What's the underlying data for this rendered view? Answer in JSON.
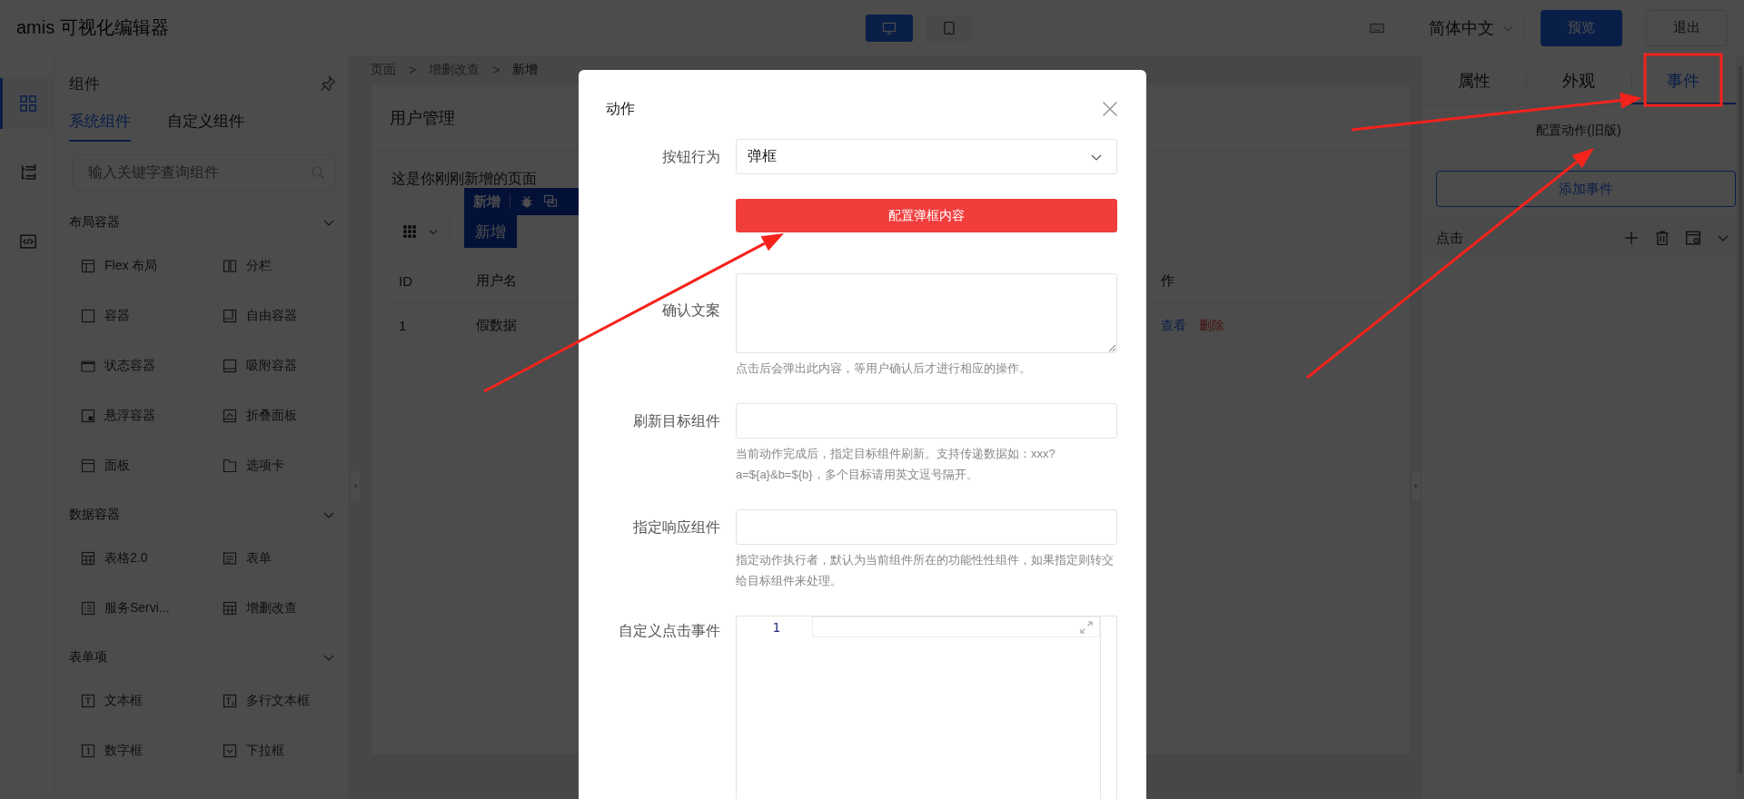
{
  "app": {
    "title": "amis 可视化编辑器"
  },
  "device_toggle": [
    {
      "kind": "desktop",
      "selected": true
    },
    {
      "kind": "tablet",
      "selected": false
    }
  ],
  "header": {
    "language": "简体中文",
    "preview_button": "预览",
    "exit_button": "退出"
  },
  "icon_rail": [
    {
      "kind": "components",
      "selected": true
    },
    {
      "kind": "outline",
      "selected": false
    },
    {
      "kind": "code",
      "selected": false
    }
  ],
  "component_panel": {
    "title": "组件",
    "tabs": [
      {
        "label": "系统组件",
        "selected": true
      },
      {
        "label": "自定义组件",
        "selected": false
      }
    ],
    "search": {
      "placeholder": "输入关键字查询组件"
    },
    "groups": [
      {
        "title": "布局容器",
        "expanded": true,
        "items": [
          {
            "label": "Flex 布局",
            "kind": "flex"
          },
          {
            "label": "分栏",
            "kind": "columns"
          },
          {
            "label": "容器",
            "kind": "container"
          },
          {
            "label": "自由容器",
            "kind": "free"
          },
          {
            "label": "状态容器",
            "kind": "state"
          },
          {
            "label": "吸附容器",
            "kind": "sticky"
          },
          {
            "label": "悬浮容器",
            "kind": "float"
          },
          {
            "label": "折叠面板",
            "kind": "collapse"
          },
          {
            "label": "面板",
            "kind": "panel"
          },
          {
            "label": "选项卡",
            "kind": "tabs"
          }
        ]
      },
      {
        "title": "数据容器",
        "expanded": true,
        "items": [
          {
            "label": "表格2.0",
            "kind": "table"
          },
          {
            "label": "表单",
            "kind": "form"
          },
          {
            "label": "服务Servi...",
            "kind": "service"
          },
          {
            "label": "增删改查",
            "kind": "table"
          }
        ]
      },
      {
        "title": "表单项",
        "expanded": true,
        "items": [
          {
            "label": "文本框",
            "kind": "text"
          },
          {
            "label": "多行文本框",
            "kind": "textarea"
          },
          {
            "label": "数字框",
            "kind": "number"
          },
          {
            "label": "下拉框",
            "kind": "select"
          }
        ]
      }
    ]
  },
  "canvas": {
    "breadcrumb": [
      {
        "label": "页面",
        "kind": "crumb"
      },
      {
        "label": ">",
        "kind": "separator"
      },
      {
        "label": "增删改查",
        "kind": "crumb"
      },
      {
        "label": ">",
        "kind": "separator"
      },
      {
        "label": "新增",
        "kind": "current"
      }
    ],
    "card": {
      "title": "用户管理",
      "description": "这是你刚刚新增的页面",
      "selection_toolbar": {
        "label": "新增"
      },
      "add_button": "新增",
      "table": {
        "columns": [
          "ID",
          "用户名",
          "作"
        ],
        "rows": [
          {
            "cells": [
              "1",
              "假数据"
            ],
            "actions": [
              {
                "label": "查看",
                "kind": "link"
              },
              {
                "label": "删除",
                "kind": "danger"
              }
            ]
          }
        ]
      }
    }
  },
  "settings_panel": {
    "tabs": [
      {
        "label": "属性",
        "selected": false
      },
      {
        "label": "外观",
        "selected": false
      },
      {
        "label": "事件",
        "selected": true
      }
    ],
    "legacy_action": "配置动作(旧版)",
    "add_event_button": "添加事件",
    "events": [
      {
        "label": "点击"
      }
    ]
  },
  "modal": {
    "title": "动作",
    "fields": [
      {
        "kind": "select",
        "label": "按钮行为",
        "value": "弹框"
      },
      {
        "kind": "button",
        "label": "配置弹框内容"
      },
      {
        "kind": "textarea",
        "label": "确认文案",
        "hint": "点击后会弹出此内容，等用户确认后才进行相应的操作。"
      },
      {
        "kind": "input",
        "label": "刷新目标组件",
        "hint": "当前动作完成后，指定目标组件刷新。支持传递数据如：xxx?a=${a}&b=${b}，多个目标请用英文逗号隔开。"
      },
      {
        "kind": "input",
        "label": "指定响应组件",
        "hint": "指定动作执行者，默认为当前组件所在的功能性性组件，如果指定则转交给目标组件来处理。"
      },
      {
        "kind": "code",
        "label": "自定义点击事件",
        "line_numbers": [
          "1"
        ]
      }
    ]
  }
}
